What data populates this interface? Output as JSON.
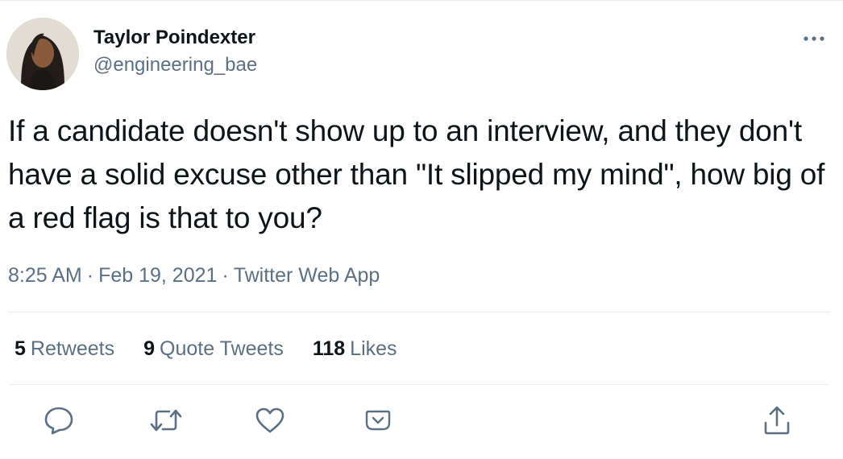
{
  "author": {
    "name": "Taylor Poindexter",
    "handle": "@engineering_bae"
  },
  "tweet": {
    "text": "If a candidate doesn't show up to an interview, and they don't have a solid excuse other than \"It slipped my mind\", how big of a red flag is that to you?",
    "time": "8:25 AM",
    "date": "Feb 19, 2021",
    "source": "Twitter Web App",
    "separator": "·"
  },
  "stats": {
    "retweets_count": "5",
    "retweets_label": "Retweets",
    "quotes_count": "9",
    "quotes_label": "Quote Tweets",
    "likes_count": "118",
    "likes_label": "Likes"
  },
  "icons": {
    "more": "more-horizontal-icon",
    "reply": "reply-icon",
    "retweet": "retweet-icon",
    "like": "heart-icon",
    "shortcut": "chevron-box-icon",
    "share": "share-icon"
  },
  "colors": {
    "text_primary": "#0f1419",
    "text_secondary": "#5b7083",
    "divider": "#e6ecf0"
  }
}
